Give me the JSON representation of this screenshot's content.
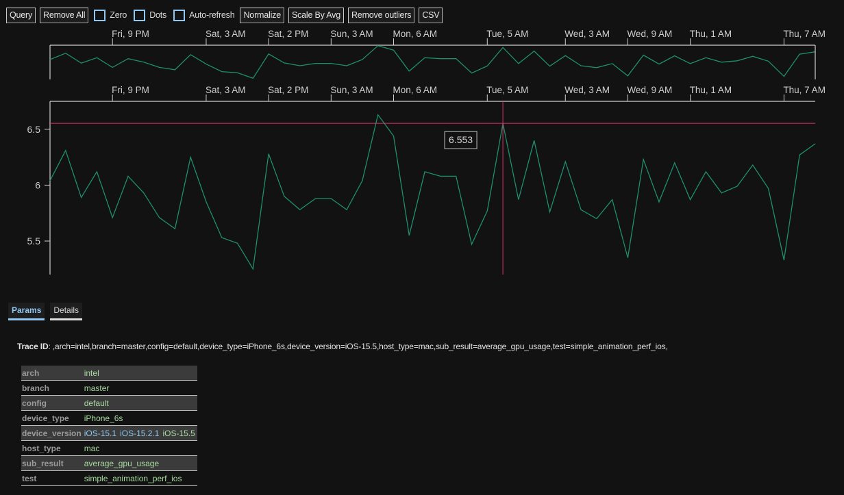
{
  "toolbar": {
    "query": "Query",
    "remove_all": "Remove All",
    "zero": "Zero",
    "dots": "Dots",
    "auto_refresh": "Auto-refresh",
    "normalize": "Normalize",
    "scale_by_avg": "Scale By Avg",
    "remove_outliers": "Remove outliers",
    "csv": "CSV"
  },
  "tabs": [
    {
      "label": "Params",
      "active": true
    },
    {
      "label": "Details",
      "active": false
    }
  ],
  "trace": {
    "label": "Trace ID",
    "value": ": ,arch=intel,branch=master,config=default,device_type=iPhone_6s,device_version=iOS-15.5,host_type=mac,sub_result=average_gpu_usage,test=simple_animation_perf_ios,"
  },
  "params": [
    {
      "key": "arch",
      "values": [
        "intel"
      ]
    },
    {
      "key": "branch",
      "values": [
        "master"
      ]
    },
    {
      "key": "config",
      "values": [
        "default"
      ]
    },
    {
      "key": "device_type",
      "values": [
        "iPhone_6s"
      ]
    },
    {
      "key": "device_version",
      "values": [
        "iOS-15.1",
        "iOS-15.2.1",
        "iOS-15.5"
      ],
      "highlighted": [
        true,
        true,
        false
      ]
    },
    {
      "key": "host_type",
      "values": [
        "mac"
      ]
    },
    {
      "key": "sub_result",
      "values": [
        "average_gpu_usage"
      ]
    },
    {
      "key": "test",
      "values": [
        "simple_animation_perf_ios"
      ]
    }
  ],
  "colors": {
    "line": "#1f8f6e",
    "crosshair": "#e2306b",
    "accent": "#8fc8f2",
    "axis": "#d0d0d0"
  },
  "chart_data": {
    "type": "line",
    "title": "",
    "xlabel": "",
    "ylabel": "",
    "x_tick_labels": [
      "Fri, 9 PM",
      "Sat, 3 AM",
      "Sat, 2 PM",
      "Sun, 3 AM",
      "Mon, 6 AM",
      "Tue, 5 AM",
      "Wed, 3 AM",
      "Wed, 9 AM",
      "Thu, 1 AM",
      "Thu, 7 AM"
    ],
    "x_tick_indices": [
      4,
      10,
      14,
      18,
      22,
      28,
      33,
      37,
      41,
      47
    ],
    "y_ticks": [
      5.5,
      6,
      6.5
    ],
    "ylim": [
      5.2,
      6.75
    ],
    "grid": false,
    "series": [
      {
        "name": ",arch=intel,branch=master,config=default,device_type=iPhone_6s,device_version=iOS-15.5,host_type=mac,sub_result=average_gpu_usage,test=simple_animation_perf_ios,",
        "values": [
          6.04,
          6.31,
          5.89,
          6.12,
          5.71,
          6.08,
          5.93,
          5.71,
          5.61,
          6.25,
          5.85,
          5.53,
          5.48,
          5.25,
          6.28,
          5.9,
          5.78,
          5.88,
          5.88,
          5.78,
          6.04,
          6.63,
          6.44,
          5.55,
          6.12,
          6.08,
          6.08,
          5.47,
          5.77,
          6.553,
          5.87,
          6.4,
          5.76,
          6.21,
          5.78,
          5.7,
          5.87,
          5.35,
          6.23,
          5.85,
          6.2,
          5.87,
          6.12,
          5.93,
          5.99,
          6.18,
          5.97,
          5.33,
          6.27,
          6.37
        ]
      }
    ],
    "crosshair": {
      "index": 29,
      "value": 6.553
    },
    "tooltip": "6.553",
    "overview": {
      "ylim": [
        5.2,
        6.65
      ]
    }
  }
}
